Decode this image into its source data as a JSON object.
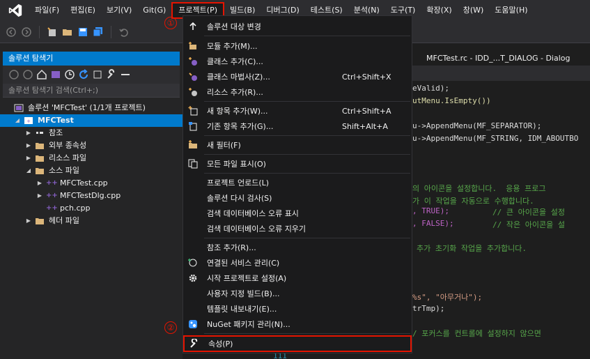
{
  "menubar": {
    "items": [
      "파일(F)",
      "편집(E)",
      "보기(V)",
      "Git(G)",
      "프로젝트(P)",
      "빌드(B)",
      "디버그(D)",
      "테스트(S)",
      "분석(N)",
      "도구(T)",
      "확장(X)",
      "창(W)",
      "도움말(H)"
    ]
  },
  "solution_explorer": {
    "title": "솔루션 탐색기",
    "search_placeholder": "솔루션 탐색기 검색(Ctrl+;)",
    "solution": "솔루션 'MFCTest' (1/1개 프로젝트)",
    "project": "MFCTest",
    "nodes": [
      "참조",
      "외부 종속성",
      "리소스 파일",
      "소스 파일",
      "MFCTest.cpp",
      "MFCTestDlg.cpp",
      "pch.cpp",
      "헤더 파일"
    ]
  },
  "editor": {
    "tab_title": "MFCTest.rc - IDD_...T_DIALOG - Dialog",
    "lines": [
      "eValid);",
      "utMenu.IsEmpty())",
      "u->AppendMenu(MF_SEPARATOR);",
      "u->AppendMenu(MF_STRING, IDM_ABOUTBO",
      "의 아이콘을 설정합니다.  응용 프로그",
      "가 이 작업을 자동으로 수행합니다.",
      ", TRUE);",
      "// 큰 아이콘을 설정",
      ", FALSE);",
      "// 작은 아이콘을 설",
      "추가 초기화 작업을 추가합니다.",
      "%s\", \"아무거나\");",
      "trTmp);",
      "/ 포커스를 컨트롤에 설정하지 않으면",
      "111"
    ]
  },
  "dropdown": {
    "items": [
      {
        "label": "솔루션 대상 변경",
        "shortcut": ""
      },
      {
        "label": "모듈 추가(M)...",
        "shortcut": ""
      },
      {
        "label": "클래스 추가(C)...",
        "shortcut": ""
      },
      {
        "label": "클래스 마법사(Z)...",
        "shortcut": "Ctrl+Shift+X"
      },
      {
        "label": "리소스 추가(R)...",
        "shortcut": ""
      },
      {
        "label": "새 항목 추가(W)...",
        "shortcut": "Ctrl+Shift+A"
      },
      {
        "label": "기존 항목 추가(G)...",
        "shortcut": "Shift+Alt+A"
      },
      {
        "label": "새 필터(F)",
        "shortcut": ""
      },
      {
        "label": "모든 파일 표시(O)",
        "shortcut": ""
      },
      {
        "label": "프로젝트 언로드(L)",
        "shortcut": ""
      },
      {
        "label": "솔루션 다시 검사(S)",
        "shortcut": ""
      },
      {
        "label": "검색 데이터베이스 오류 표시",
        "shortcut": ""
      },
      {
        "label": "검색 데이터베이스 오류 지우기",
        "shortcut": ""
      },
      {
        "label": "참조 추가(R)...",
        "shortcut": ""
      },
      {
        "label": "연결된 서비스 관리(C)",
        "shortcut": ""
      },
      {
        "label": "시작 프로젝트로 설정(A)",
        "shortcut": ""
      },
      {
        "label": "사용자 지정 빌드(B)...",
        "shortcut": ""
      },
      {
        "label": "템플릿 내보내기(E)...",
        "shortcut": ""
      },
      {
        "label": "NuGet 패키지 관리(N)...",
        "shortcut": ""
      },
      {
        "label": "속성(P)",
        "shortcut": ""
      }
    ]
  },
  "annotations": {
    "marker1": "①",
    "marker2": "②"
  },
  "colors": {
    "accent": "#007acc",
    "highlight": "#e51400",
    "menu_bg": "#1b1b1c",
    "vs_purple": "#865fc5"
  }
}
